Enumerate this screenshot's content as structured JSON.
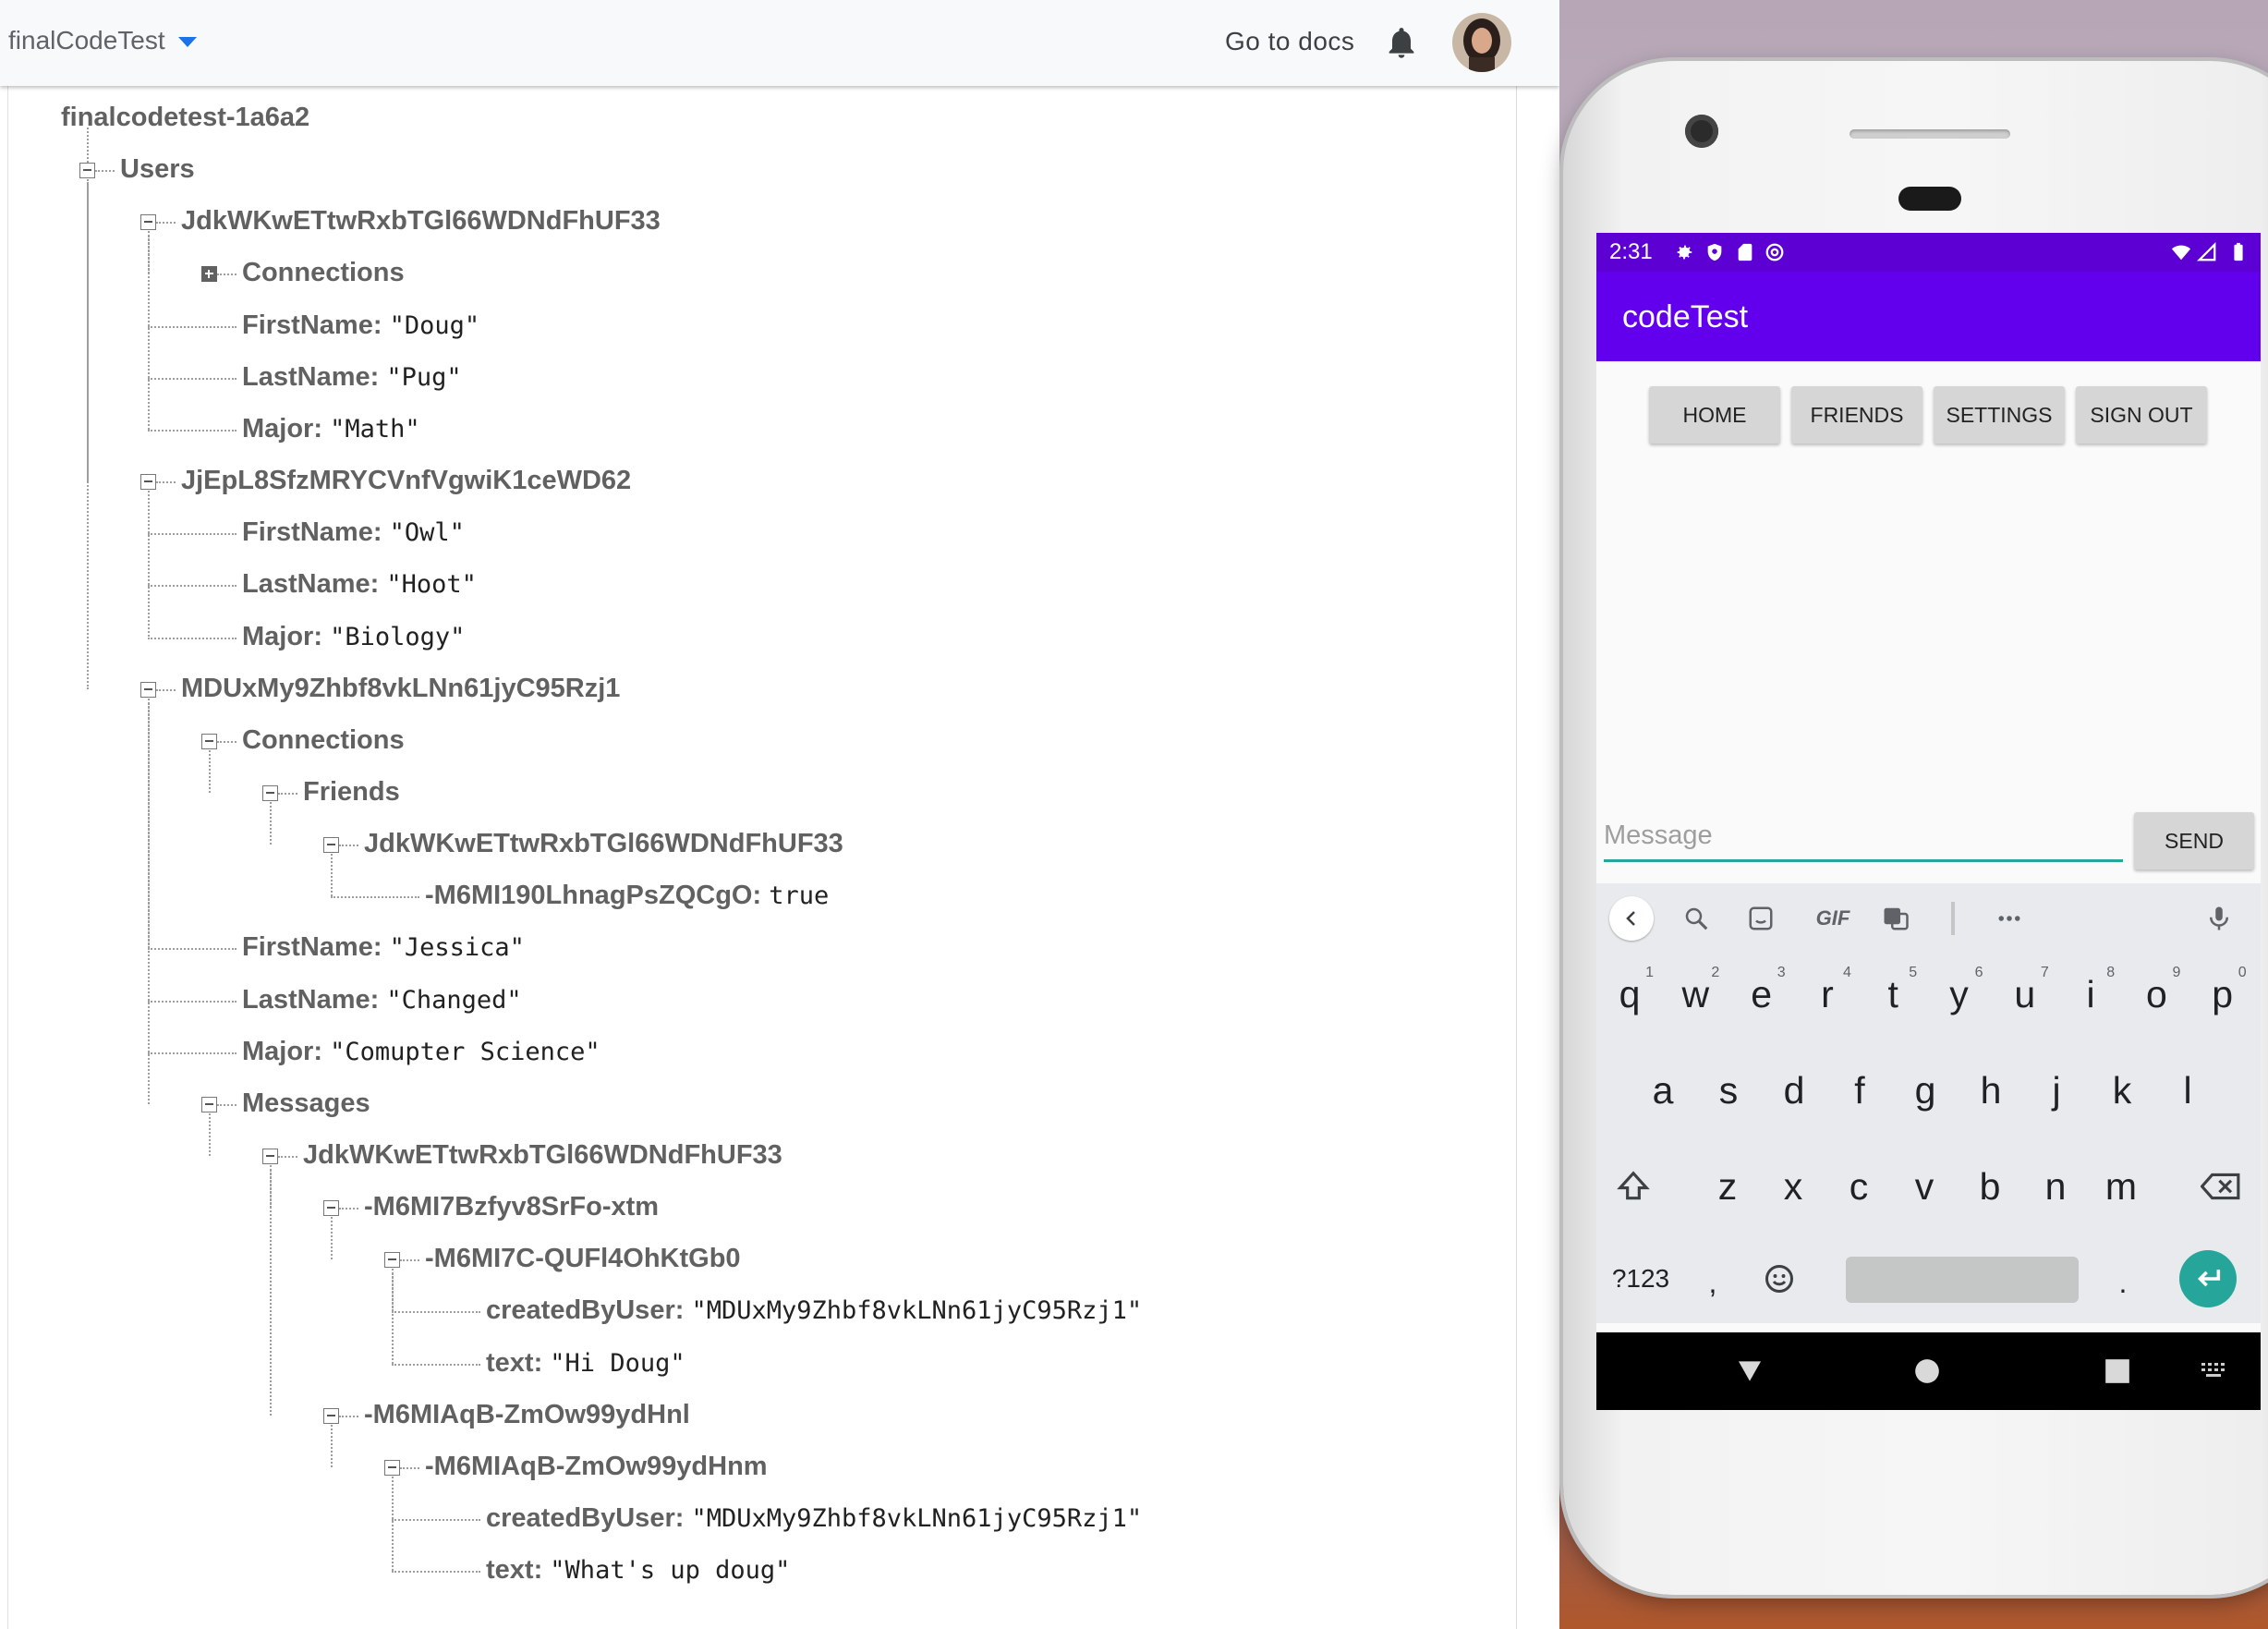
{
  "console": {
    "project_name": "finalCodeTest",
    "go_to_docs": "Go to docs",
    "icons": {
      "project_caret": "caret-down-icon",
      "notifications": "bell-icon",
      "user": "avatar"
    },
    "tree": [
      {
        "key": "finalcodetest-1a6a2",
        "value": null
      },
      {
        "key": "Users",
        "value": null
      },
      {
        "key": "JdkWKwETtwRxbTGl66WDNdFhUF33",
        "value": null
      },
      {
        "key": "Connections",
        "value": null
      },
      {
        "key": "FirstName:",
        "value": "\"Doug\""
      },
      {
        "key": "LastName:",
        "value": "\"Pug\""
      },
      {
        "key": "Major:",
        "value": "\"Math\""
      },
      {
        "key": "JjEpL8SfzMRYCVnfVgwiK1ceWD62",
        "value": null
      },
      {
        "key": "FirstName:",
        "value": "\"Owl\""
      },
      {
        "key": "LastName:",
        "value": "\"Hoot\""
      },
      {
        "key": "Major:",
        "value": "\"Biology\""
      },
      {
        "key": "MDUxMy9Zhbf8vkLNn61jyC95Rzj1",
        "value": null
      },
      {
        "key": "Connections",
        "value": null
      },
      {
        "key": "Friends",
        "value": null
      },
      {
        "key": "JdkWKwETtwRxbTGl66WDNdFhUF33",
        "value": null
      },
      {
        "key": "-M6MI190LhnagPsZQCgO:",
        "value": "true"
      },
      {
        "key": "FirstName:",
        "value": "\"Jessica\""
      },
      {
        "key": "LastName:",
        "value": "\"Changed\""
      },
      {
        "key": "Major:",
        "value": "\"Comupter Science\""
      },
      {
        "key": "Messages",
        "value": null
      },
      {
        "key": "JdkWKwETtwRxbTGl66WDNdFhUF33",
        "value": null
      },
      {
        "key": "-M6MI7Bzfyv8SrFo-xtm",
        "value": null
      },
      {
        "key": "-M6MI7C-QUFl4OhKtGb0",
        "value": null
      },
      {
        "key": "createdByUser:",
        "value": "\"MDUxMy9Zhbf8vkLNn61jyC95Rzj1\""
      },
      {
        "key": "text:",
        "value": "\"Hi Doug\""
      },
      {
        "key": "-M6MIAqB-ZmOw99ydHnl",
        "value": null
      },
      {
        "key": "-M6MIAqB-ZmOw99ydHnm",
        "value": null
      },
      {
        "key": "createdByUser:",
        "value": "\"MDUxMy9Zhbf8vkLNn61jyC95Rzj1\""
      },
      {
        "key": "text:",
        "value": "\"What's up doug\""
      }
    ]
  },
  "phone": {
    "status": {
      "time": "2:31",
      "left_icons": [
        "settings-icon",
        "shield-icon",
        "sd-card-icon",
        "at-sign-icon"
      ],
      "right_icons": [
        "wifi-icon",
        "signal-icon",
        "battery-icon"
      ]
    },
    "app_title": "codeTest",
    "nav_buttons": [
      "HOME",
      "FRIENDS",
      "SETTINGS",
      "SIGN OUT"
    ],
    "message_placeholder": "Message",
    "send_label": "SEND",
    "keyboard": {
      "toolbar": [
        "back-chevron-icon",
        "search-icon",
        "sticker-icon",
        "GIF",
        "translate-icon",
        "more-icon",
        "mic-icon"
      ],
      "row1": [
        "q",
        "w",
        "e",
        "r",
        "t",
        "y",
        "u",
        "i",
        "o",
        "p"
      ],
      "row1_hints": [
        "1",
        "2",
        "3",
        "4",
        "5",
        "6",
        "7",
        "8",
        "9",
        "0"
      ],
      "row2": [
        "a",
        "s",
        "d",
        "f",
        "g",
        "h",
        "j",
        "k",
        "l"
      ],
      "row3": [
        "z",
        "x",
        "c",
        "v",
        "b",
        "n",
        "m"
      ],
      "symbols": "?123",
      "comma": ",",
      "period": "."
    },
    "nav": [
      "back-icon",
      "home-icon",
      "recents-icon",
      "keyboard-switch-icon"
    ]
  },
  "colors": {
    "app_primary": "#6200ee",
    "status_bar": "#5c00d3",
    "accent": "#26a69a",
    "link": "#1a73e8"
  }
}
